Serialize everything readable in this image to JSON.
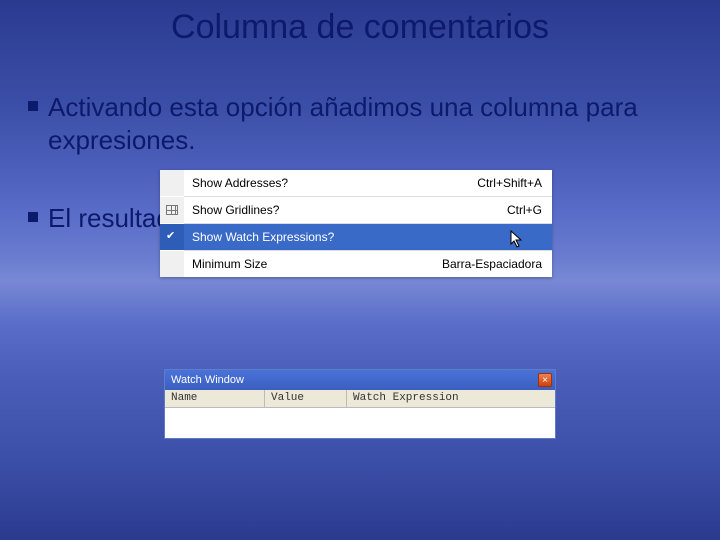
{
  "title": "Columna de comentarios",
  "bullets": {
    "b1": "Activando esta opción añadimos una columna para expresiones.",
    "b2": "El resultado es:"
  },
  "menu": {
    "items": [
      {
        "label": "Show Addresses?",
        "shortcut": "Ctrl+Shift+A",
        "icon": ""
      },
      {
        "label": "Show Gridlines?",
        "shortcut": "Ctrl+G",
        "icon": "grid"
      },
      {
        "label": "Show Watch Expressions?",
        "shortcut": "",
        "icon": "check",
        "selected": true
      },
      {
        "label": "Minimum Size",
        "shortcut": "Barra-Espaciadora",
        "icon": "arrow"
      }
    ]
  },
  "watch": {
    "title": "Watch Window",
    "close": "×",
    "columns": {
      "name": "Name",
      "value": "Value",
      "expr": "Watch Expression"
    }
  }
}
